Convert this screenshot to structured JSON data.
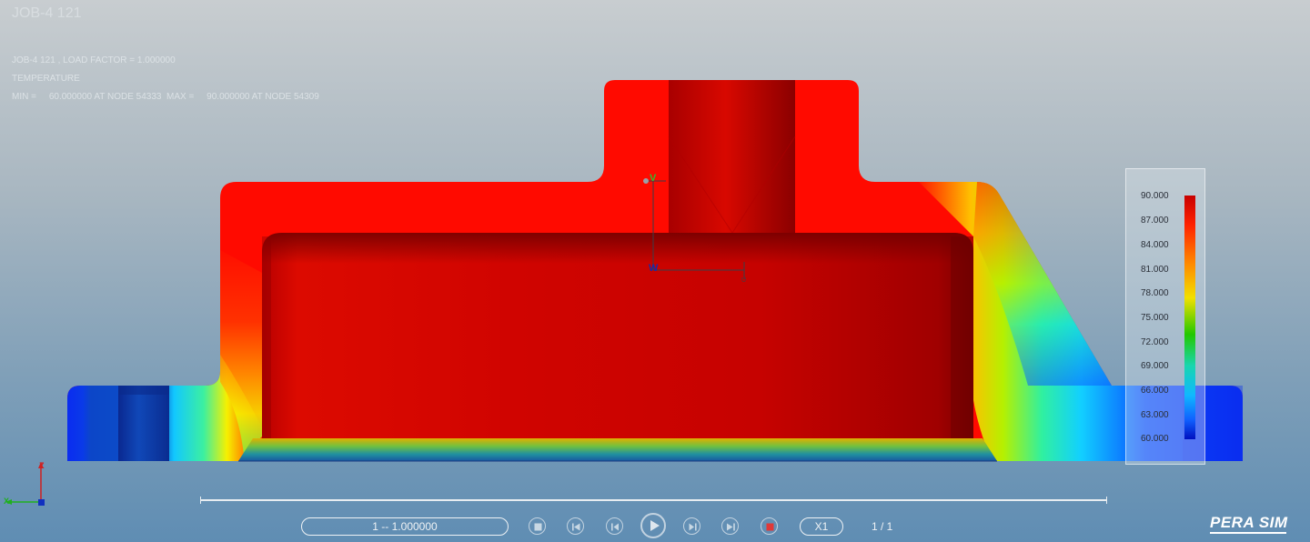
{
  "header": {
    "job_title": "JOB-4 121",
    "line1": "JOB-4 121 , LOAD FACTOR = 1.000000",
    "line2": "TEMPERATURE",
    "line3": "MIN =     60.000000 AT NODE 54333  MAX =     90.000000 AT NODE 54309"
  },
  "legend": {
    "ticks": [
      "90.000",
      "87.000",
      "84.000",
      "81.000",
      "78.000",
      "75.000",
      "72.000",
      "69.000",
      "66.000",
      "63.000",
      "60.000"
    ],
    "min": 60.0,
    "max": 90.0
  },
  "axes": {
    "local_v": "V",
    "local_w": "W",
    "local_u": "U",
    "global_x": "X",
    "global_z": "Z"
  },
  "playback": {
    "frame_label": "1 -- 1.000000",
    "speed_label": "X1",
    "counter": "1 / 1"
  },
  "brand": "PERA SIM",
  "icons": {
    "stop": "stop-icon",
    "first": "skip-first-icon",
    "prev": "step-back-icon",
    "play": "play-icon",
    "next": "step-forward-icon",
    "last": "skip-last-icon",
    "record": "record-icon"
  }
}
